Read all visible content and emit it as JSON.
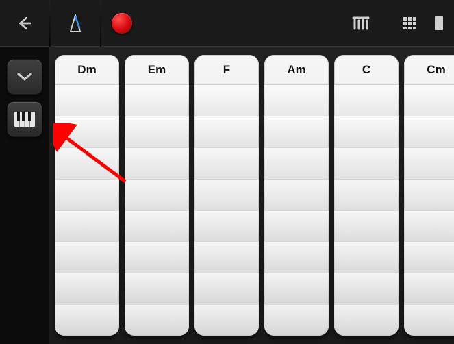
{
  "toolbar": {
    "back": "Back",
    "metronome": "Metronome",
    "record": "Record",
    "arpeggiator": "Arpeggiator",
    "grid": "Grid View",
    "more": "More"
  },
  "sidebar": {
    "chevron": "Collapse",
    "keyboard": "Keyboard Mode"
  },
  "chords": [
    "Dm",
    "Em",
    "F",
    "Am",
    "C",
    "Cm"
  ],
  "rows_per_chord": 8,
  "colors": {
    "accent_blue": "#0e6ac8",
    "record_red": "#d6090e"
  },
  "annotation": {
    "arrow_target": "keyboard-mode-button"
  }
}
